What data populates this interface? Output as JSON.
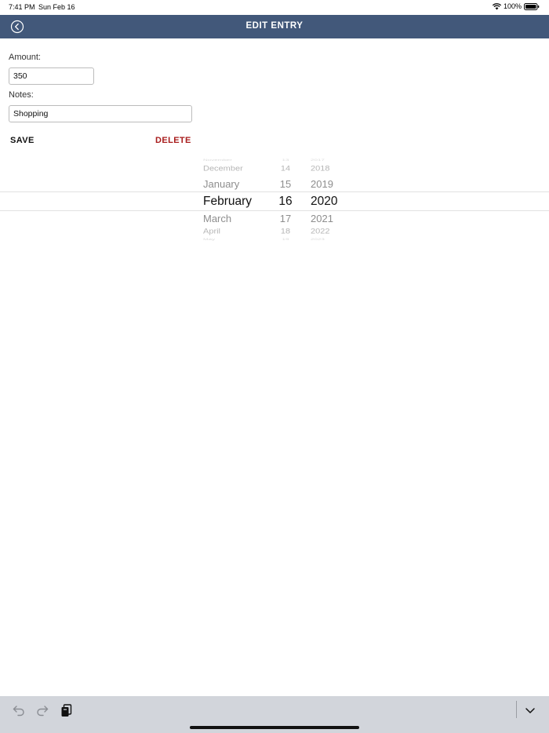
{
  "status_bar": {
    "time": "7:41 PM",
    "date": "Sun Feb 16",
    "battery_percent": "100%"
  },
  "nav": {
    "title": "EDIT ENTRY"
  },
  "form": {
    "amount_label": "Amount:",
    "amount_value": "350",
    "notes_label": "Notes:",
    "notes_value": "Shopping",
    "save_label": "SAVE",
    "delete_label": "DELETE"
  },
  "date_picker": {
    "months": [
      "November",
      "December",
      "January",
      "February",
      "March",
      "April",
      "May"
    ],
    "days": [
      "13",
      "14",
      "15",
      "16",
      "17",
      "18",
      "19"
    ],
    "years": [
      "2017",
      "2018",
      "2019",
      "2020",
      "2021",
      "2022",
      "2023"
    ],
    "selected": {
      "month": "February",
      "day": "16",
      "year": "2020"
    }
  },
  "accessory_bar": {
    "icons": [
      "undo-icon",
      "redo-icon",
      "paste-icon",
      "chevron-down-icon"
    ]
  },
  "colors": {
    "nav_background": "#42587a",
    "delete_text": "#a81c1c",
    "accessory_background": "#d2d5db"
  }
}
